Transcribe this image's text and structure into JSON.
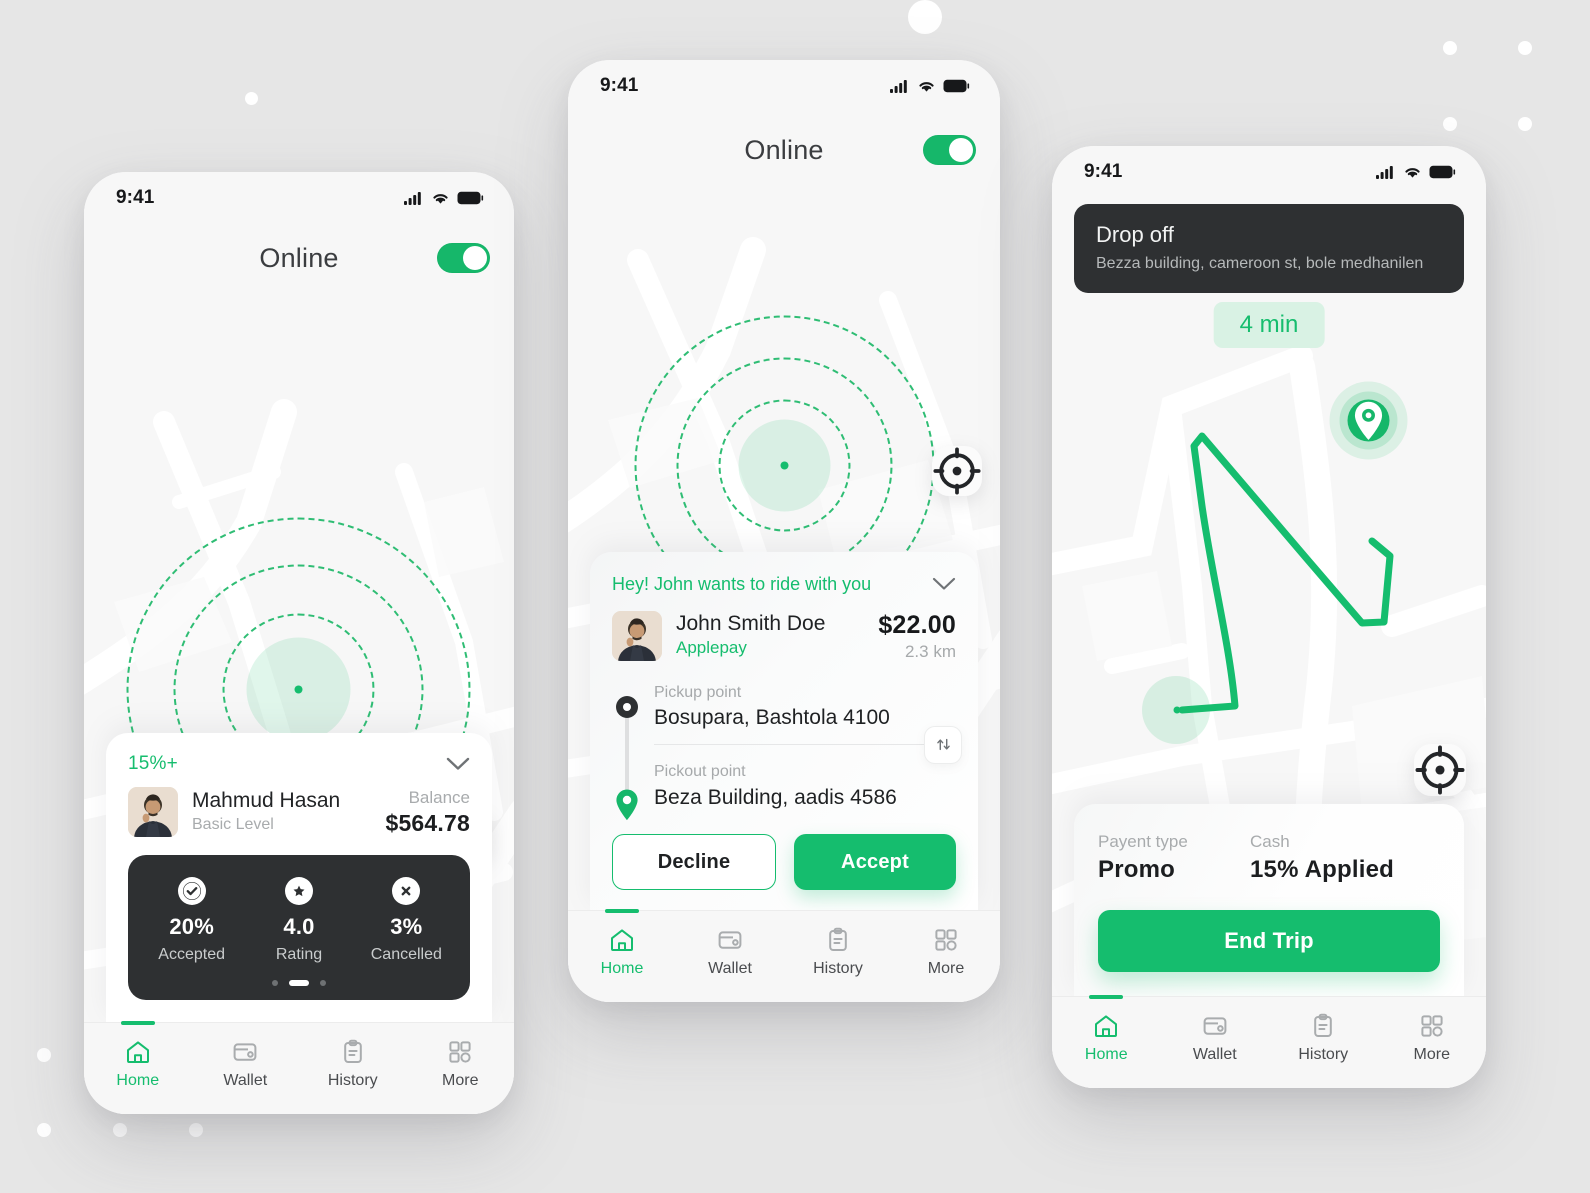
{
  "canvas": {
    "background_color": "#e6e6e6",
    "accent_green": "#15bd6e",
    "dark": "#2e3032"
  },
  "phone1": {
    "status": {
      "time": "9:41",
      "signal_icon": "cellular-signal-icon",
      "wifi_icon": "wifi-icon",
      "battery_icon": "battery-icon"
    },
    "header": {
      "title": "Online",
      "toggle_state": "on"
    },
    "map": {
      "locate_icon": "locate-target-icon",
      "car_icon": "car-top-view-icon"
    },
    "card": {
      "percent": "15%+",
      "collapse_icon": "chevron-down-icon",
      "name": "Mahmud Hasan",
      "level": "Basic Level",
      "balance_label": "Balance",
      "balance_value": "$564.78",
      "stats": [
        {
          "icon": "check-circle-icon",
          "value": "20%",
          "label": "Accepted"
        },
        {
          "icon": "star-circle-icon",
          "value": "4.0",
          "label": "Rating"
        },
        {
          "icon": "x-circle-icon",
          "value": "3%",
          "label": "Cancelled"
        }
      ],
      "pager": {
        "total": 3,
        "active_index": 1
      }
    },
    "nav": [
      {
        "id": "home",
        "label": "Home",
        "icon": "home-icon",
        "active": true
      },
      {
        "id": "wallet",
        "label": "Wallet",
        "icon": "wallet-icon",
        "active": false
      },
      {
        "id": "history",
        "label": "History",
        "icon": "clipboard-icon",
        "active": false
      },
      {
        "id": "more",
        "label": "More",
        "icon": "grid-icon",
        "active": false
      }
    ]
  },
  "phone2": {
    "status": {
      "time": "9:41"
    },
    "header": {
      "title": "Online",
      "toggle_state": "on"
    },
    "map": {
      "locate_icon": "locate-target-icon",
      "car_icon": "car-top-view-icon"
    },
    "request": {
      "headline": "Hey! John wants to ride with you",
      "collapse_icon": "chevron-down-icon",
      "rider_name": "John Smith Doe",
      "payment_method": "Applepay",
      "price": "$22.00",
      "distance": "2.3 km",
      "pickup_label": "Pickup point",
      "pickup_value": "Bosupara, Bashtola 4100",
      "dropoff_label": "Pickout point",
      "dropoff_value": "Beza Building, aadis 4586",
      "swap_icon": "swap-vertical-icon",
      "decline_label": "Decline",
      "accept_label": "Accept"
    },
    "nav": [
      {
        "id": "home",
        "label": "Home",
        "icon": "home-icon",
        "active": true
      },
      {
        "id": "wallet",
        "label": "Wallet",
        "icon": "wallet-icon",
        "active": false
      },
      {
        "id": "history",
        "label": "History",
        "icon": "clipboard-icon",
        "active": false
      },
      {
        "id": "more",
        "label": "More",
        "icon": "grid-icon",
        "active": false
      }
    ]
  },
  "phone3": {
    "status": {
      "time": "9:41"
    },
    "banner": {
      "title": "Drop off",
      "address": "Bezza building, cameroon st, bole medhanilen"
    },
    "eta": "4 min",
    "map": {
      "locate_icon": "locate-target-icon",
      "car_icon": "car-top-view-icon",
      "destination_icon": "map-pin-icon",
      "route_color": "#15bd6e"
    },
    "payment": {
      "type_label": "Payent type",
      "type_value": "Promo",
      "cash_label": "Cash",
      "cash_value": "15% Applied",
      "end_trip_label": "End Trip"
    },
    "nav": [
      {
        "id": "home",
        "label": "Home",
        "icon": "home-icon",
        "active": true
      },
      {
        "id": "wallet",
        "label": "Wallet",
        "icon": "wallet-icon",
        "active": false
      },
      {
        "id": "history",
        "label": "History",
        "icon": "clipboard-icon",
        "active": false
      },
      {
        "id": "more",
        "label": "More",
        "icon": "grid-icon",
        "active": false
      }
    ]
  }
}
